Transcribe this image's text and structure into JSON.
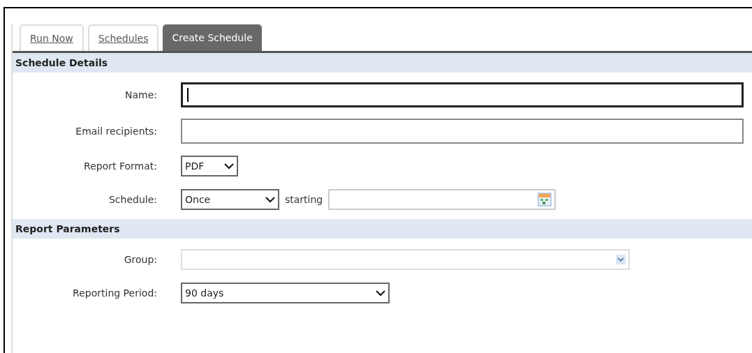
{
  "tabs": [
    {
      "label": "Run Now",
      "selected": false
    },
    {
      "label": "Schedules",
      "selected": false
    },
    {
      "label": "Create Schedule",
      "selected": true
    }
  ],
  "sections": [
    {
      "title": "Schedule Details",
      "fields": [
        {
          "kind": "text",
          "label": "Name:",
          "focused": true
        },
        {
          "kind": "text",
          "label": "Email recipients:",
          "focused": false
        },
        {
          "kind": "select",
          "label": "Report Format:",
          "value": "PDF"
        },
        {
          "kind": "schedule",
          "label": "Schedule:",
          "value": "Once",
          "connector": "starting"
        }
      ]
    },
    {
      "title": "Report Parameters",
      "fields": [
        {
          "kind": "combo",
          "label": "Group:",
          "disabled": true
        },
        {
          "kind": "dropdown",
          "label": "Reporting Period:",
          "value": "90 days"
        }
      ]
    }
  ]
}
